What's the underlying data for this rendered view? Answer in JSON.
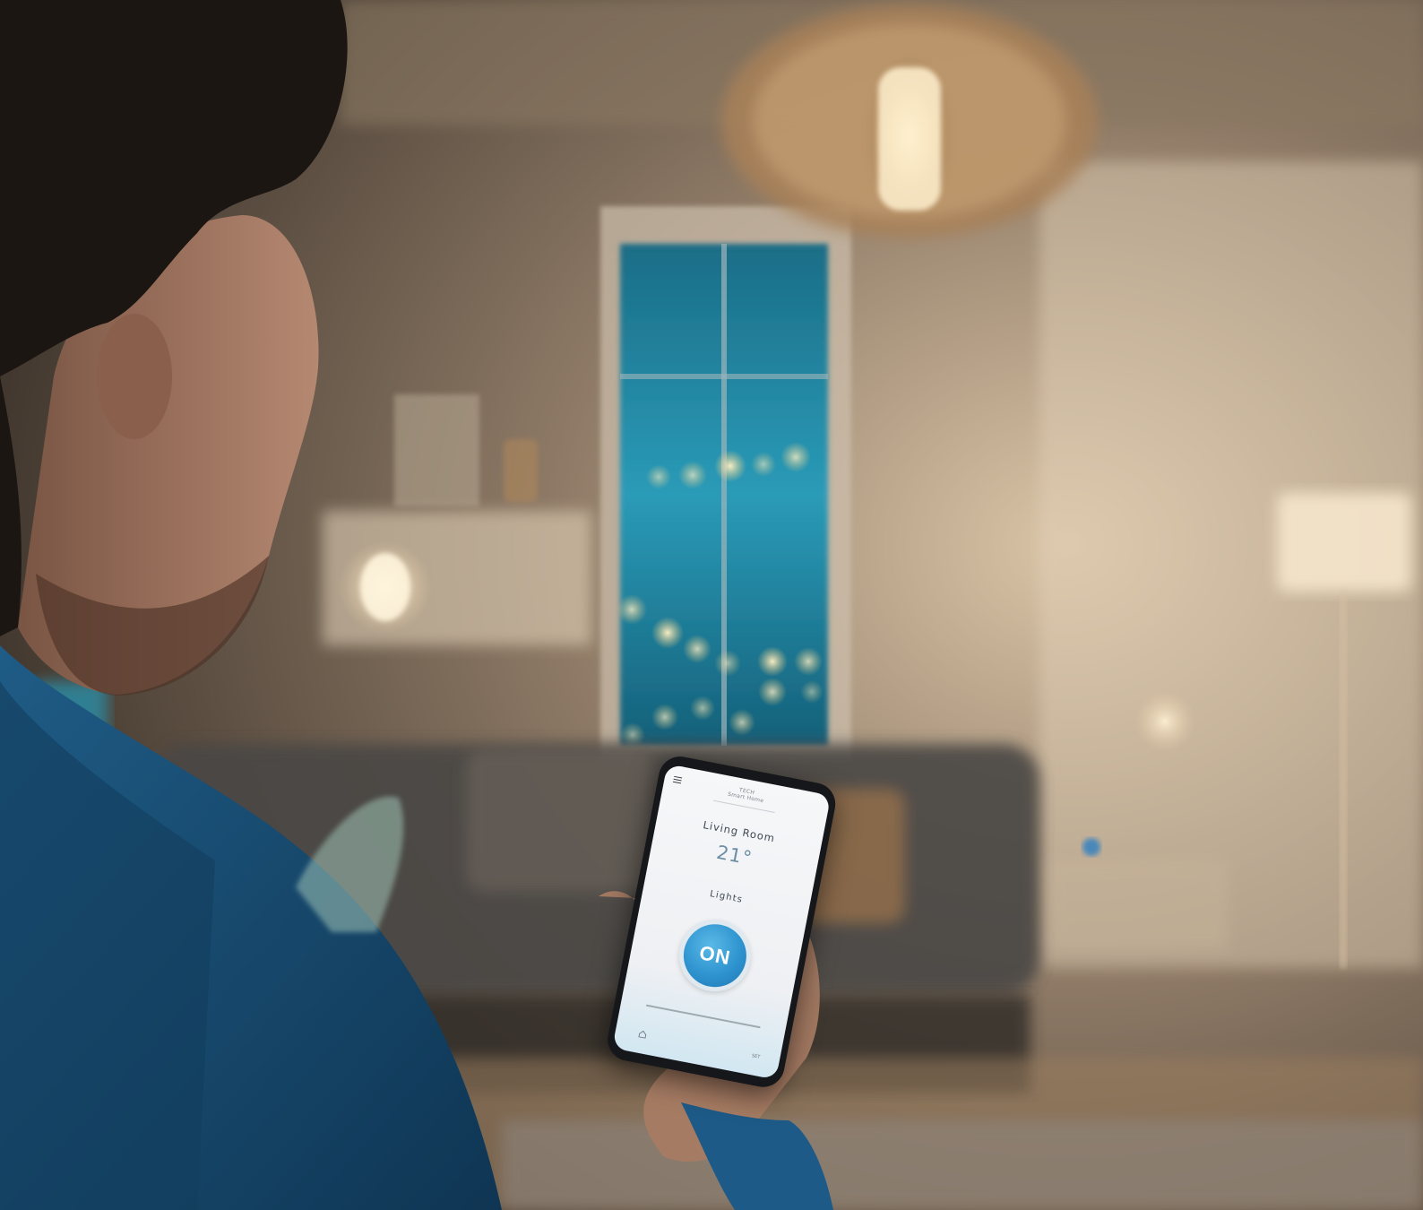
{
  "app": {
    "brand_line1": "TECH",
    "brand_line2": "Smart Home",
    "room": "Living Room",
    "temperature": "21°",
    "section": "Lights",
    "power_state": "ON",
    "nav_extra": "SET"
  },
  "colors": {
    "accent": "#2e93cf",
    "temperature_text": "#6b8ea4",
    "screen_bg": "#f6f7f9"
  },
  "icons": [
    "menu-icon",
    "home-icon"
  ]
}
